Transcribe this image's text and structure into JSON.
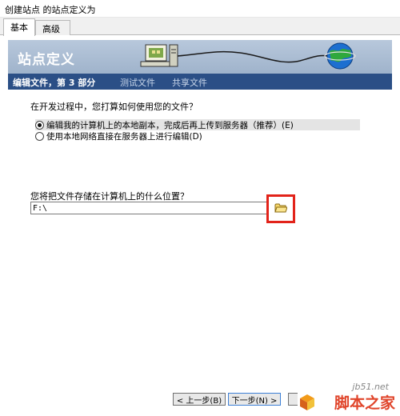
{
  "window": {
    "title": "创建站点 的站点定义为"
  },
  "tabs": [
    {
      "label": "基本",
      "active": true
    },
    {
      "label": "高级",
      "active": false
    }
  ],
  "banner": {
    "title": "站点定义"
  },
  "steps": {
    "current": "编辑文件，第 3 部分",
    "test": "测试文件",
    "share": "共享文件"
  },
  "question_usage": "在开发过程中，您打算如何使用您的文件？",
  "options": [
    {
      "label": "编辑我的计算机上的本地副本，完成后再上传到服务器（推荐）(E)",
      "checked": true
    },
    {
      "label": "使用本地网络直接在服务器上进行编辑(D)",
      "checked": false
    }
  ],
  "question_location": "您将把文件存储在计算机上的什么位置？",
  "path": {
    "value": "F:\\"
  },
  "buttons": {
    "back": "< 上一步(B)",
    "next": "下一步(N) >"
  },
  "watermark": {
    "url": "jb51.net",
    "name": "脚本之家"
  },
  "colors": {
    "step_bar": "#2b4f86",
    "highlight": "#e2231a",
    "banner": "#a8bbd1"
  }
}
